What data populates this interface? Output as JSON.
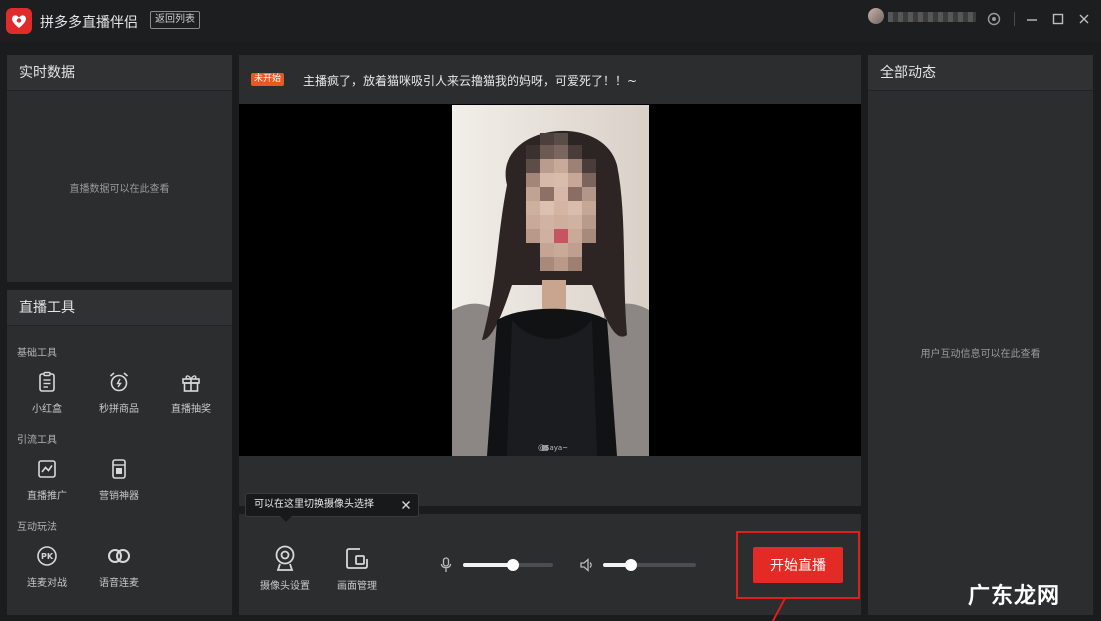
{
  "app": {
    "title": "拼多多直播伴侣",
    "back_button_label": "返回列表"
  },
  "left": {
    "realtime": {
      "title": "实时数据",
      "placeholder": "直播数据可以在此查看"
    },
    "tools": {
      "title": "直播工具",
      "sections": [
        {
          "title": "基础工具",
          "items": [
            "小红盒",
            "秒拼商品",
            "直播抽奖"
          ]
        },
        {
          "title": "引流工具",
          "items": [
            "直播推广",
            "营销神器"
          ]
        },
        {
          "title": "互动玩法",
          "items": [
            "连麦对战",
            "语音连麦"
          ]
        }
      ],
      "pk_glyph": "PK"
    }
  },
  "center": {
    "badge": "未开始",
    "notice": "主播疯了，放着猫咪吸引人来云撸猫我的妈呀，可爱死了！！~",
    "photo_caption": "@Saya~",
    "tooltip": "可以在这里切换摄像头选择",
    "camera_settings": "摄像头设置",
    "scene_manage": "画面管理",
    "mic_level": 0.56,
    "speaker_level": 0.3,
    "start_button": "开始直播"
  },
  "right": {
    "title": "全部动态",
    "placeholder": "用户互动信息可以在此查看"
  },
  "watermark": "广东龙网",
  "colors": {
    "brand_red": "#e42a24",
    "badge_orange": "#e8581f",
    "panel": "#2b2d2f",
    "background": "#1b1c1e"
  }
}
